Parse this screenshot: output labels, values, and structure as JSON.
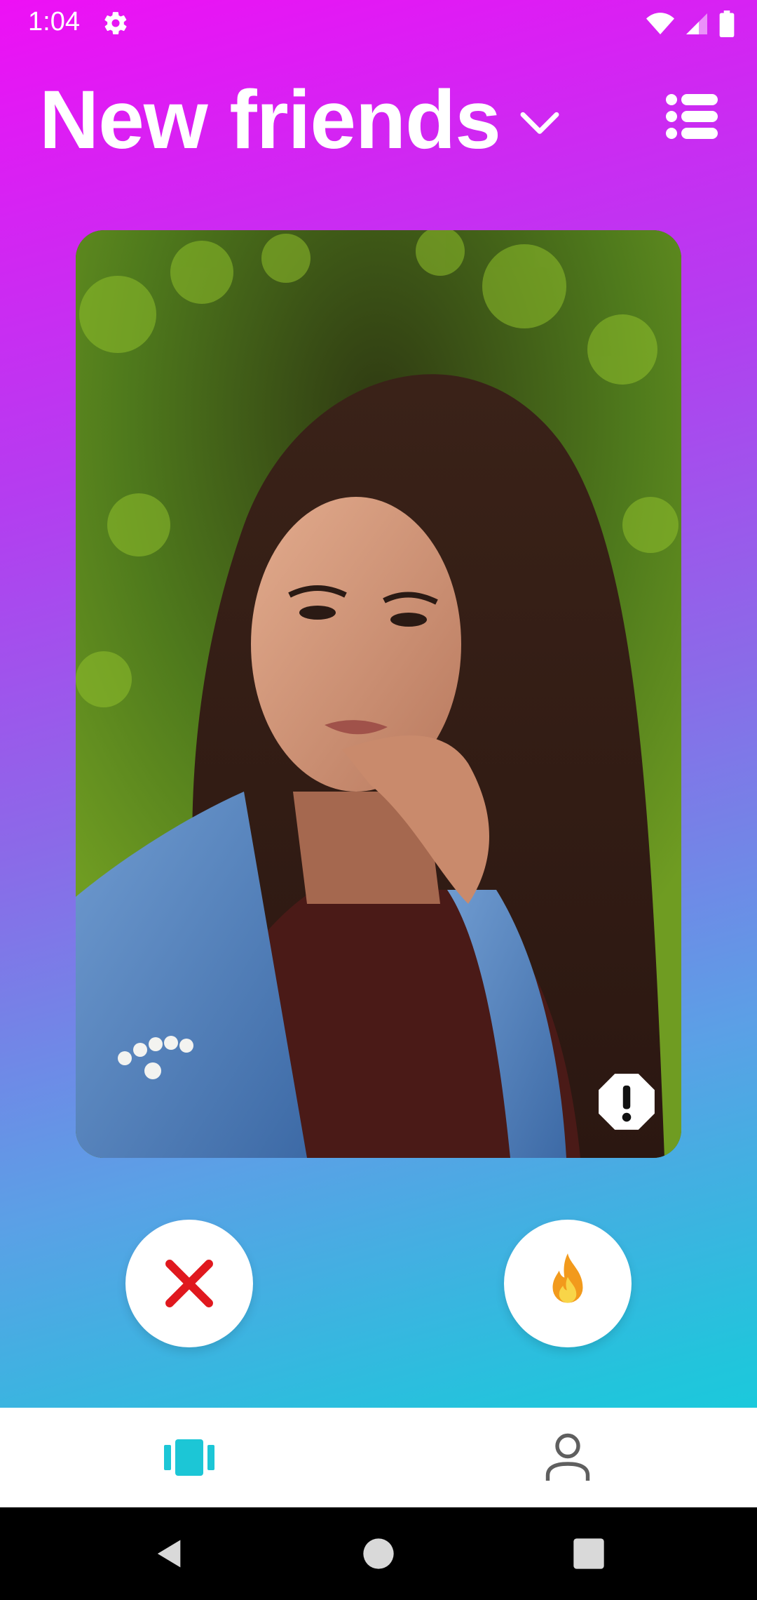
{
  "status_bar": {
    "time": "1:04"
  },
  "header": {
    "title": "New friends"
  },
  "card": {
    "photo_alt": "Profile photo"
  },
  "colors": {
    "accent_teal": "#1CC6D6",
    "dislike_red": "#E0181E",
    "flame_orange": "#F29A1C",
    "nav_inactive": "#5f5f5f"
  },
  "icons": {
    "settings": "gear-icon",
    "menu": "list-icon",
    "dropdown": "chevron-down-icon",
    "report": "exclamation-icon",
    "dislike": "x-icon",
    "like": "flame-icon",
    "nav_cards": "cards-icon",
    "nav_profile": "person-icon"
  }
}
